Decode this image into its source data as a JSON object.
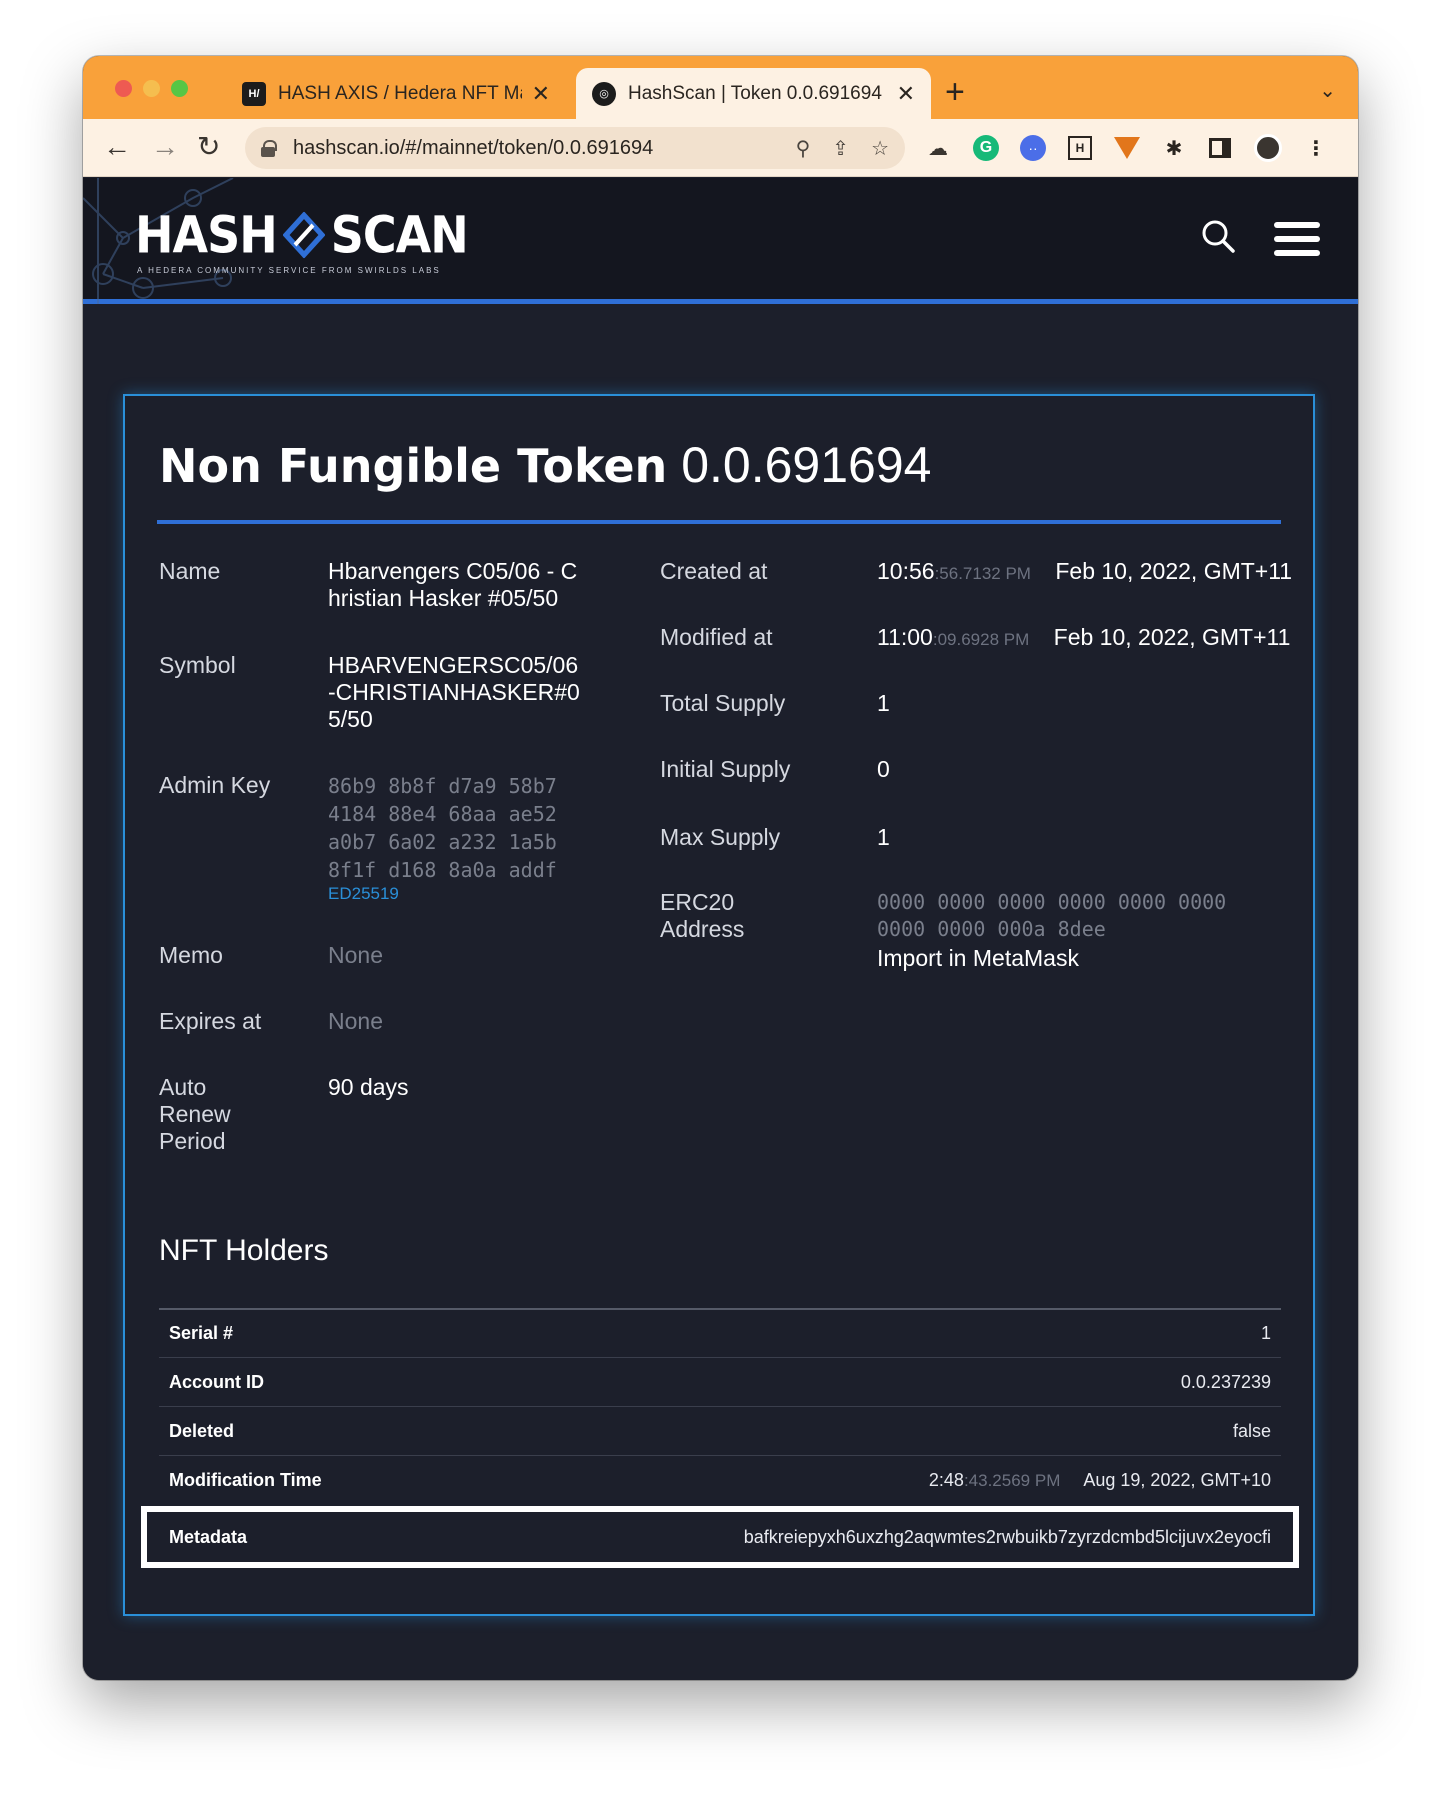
{
  "browser": {
    "tabs": [
      {
        "favicon": "H/",
        "label": "HASH AXIS / Hedera NFT Mark"
      },
      {
        "favicon": "◎",
        "label": "HashScan | Token 0.0.691694"
      }
    ],
    "url": "hashscan.io/#/mainnet/token/0.0.691694"
  },
  "site": {
    "logo_left": "HASH",
    "logo_right": "SCAN",
    "logo_tagline": "A HEDERA COMMUNITY SERVICE FROM SWIRLDS LABS"
  },
  "token": {
    "title_type": "Non Fungible Token",
    "title_id": "0.0.691694",
    "left_fields": {
      "name": {
        "label": "Name",
        "value_line1": "Hbarvengers C05/06 - C",
        "value_line2": "hristian Hasker #05/50"
      },
      "symbol": {
        "label": "Symbol",
        "value_line1": "HBARVENGERSC05/06",
        "value_line2": "-CHRISTIANHASKER#0",
        "value_line3": "5/50"
      },
      "admin_key": {
        "label": "Admin Key",
        "line1": "86b9 8b8f d7a9 58b7",
        "line2": "4184 88e4 68aa ae52",
        "line3": "a0b7 6a02 a232 1a5b",
        "line4": "8f1f d168 8a0a addf",
        "key_type": "ED25519"
      },
      "memo": {
        "label": "Memo",
        "value": "None"
      },
      "expires_at": {
        "label": "Expires at",
        "value": "None"
      },
      "auto_renew": {
        "label_line1": "Auto",
        "label_line2": "Renew",
        "label_line3": "Period",
        "value": "90 days"
      }
    },
    "right_fields": {
      "created_at": {
        "label": "Created at",
        "time": "10:56",
        "time_fraction": ":56.7132 PM",
        "date": "Feb 10, 2022, GMT+11"
      },
      "modified_at": {
        "label": "Modified at",
        "time": "11:00",
        "time_fraction": ":09.6928 PM",
        "date": "Feb 10, 2022, GMT+11"
      },
      "total_supply": {
        "label": "Total Supply",
        "value": "1"
      },
      "initial_supply": {
        "label": "Initial Supply",
        "value": "0"
      },
      "max_supply": {
        "label": "Max Supply",
        "value": "1"
      },
      "erc20": {
        "label_line1": "ERC20",
        "label_line2": "Address",
        "line1": "0000 0000 0000 0000 0000 0000",
        "line2": "0000 0000 000a 8dee",
        "metamask": "Import in MetaMask"
      }
    }
  },
  "holders": {
    "title": "NFT Holders",
    "rows": {
      "serial": {
        "key": "Serial #",
        "value": "1"
      },
      "account": {
        "key": "Account ID",
        "value": "0.0.237239"
      },
      "deleted": {
        "key": "Deleted",
        "value": "false"
      },
      "mod_time": {
        "key": "Modification Time",
        "time": "2:48",
        "time_fraction": ":43.2569 PM",
        "date": "Aug 19, 2022, GMT+10"
      },
      "metadata": {
        "key": "Metadata",
        "value": "bafkreiepyxh6uxzhg2aqwmtes2rwbuikb7zyrzdcmbd5lcijuvx2eyocfi"
      }
    }
  },
  "colors": {
    "accent": "#2f6fd6",
    "card_border": "#2a8fd8",
    "page_bg": "#1c1f2b",
    "chrome": "#f9a13a"
  }
}
